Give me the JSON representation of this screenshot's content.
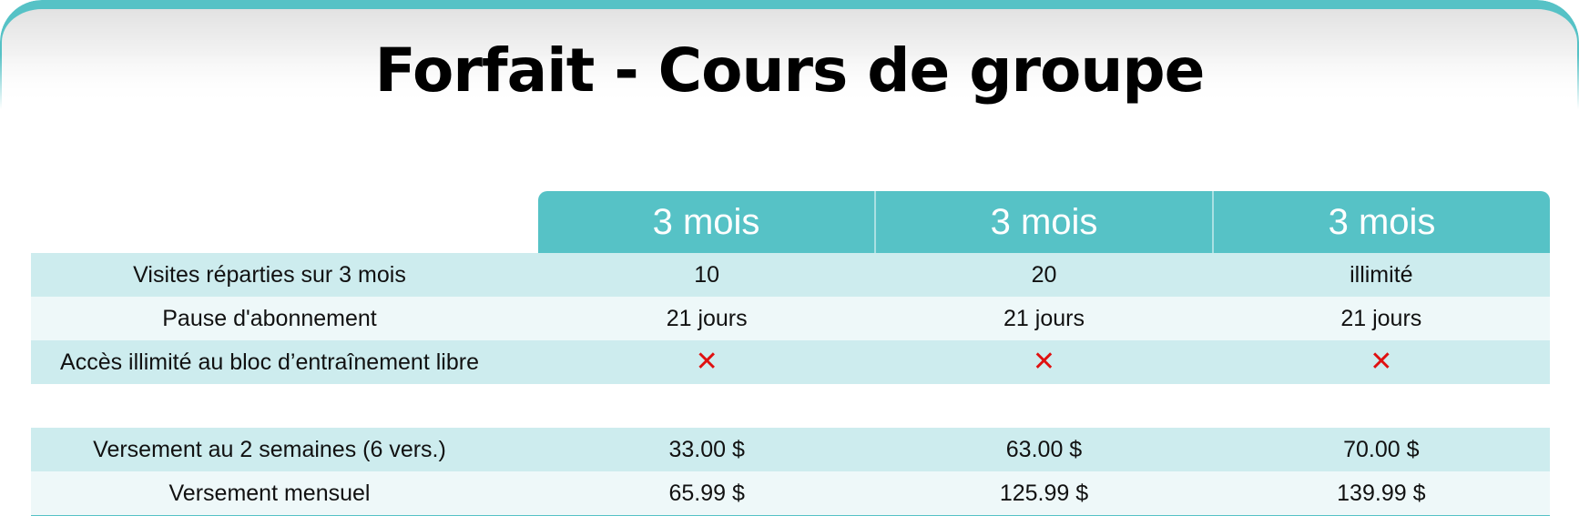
{
  "title": "Forfait - Cours de groupe",
  "colors": {
    "accent": "#56c2c6",
    "row_dark": "#cdecee",
    "row_light": "#eef8f9",
    "cross": "#e01010"
  },
  "plans": [
    "3 mois",
    "3 mois",
    "3 mois"
  ],
  "feature_rows": [
    {
      "label": "Visites réparties sur 3 mois",
      "values": [
        "10",
        "20",
        "illimité"
      ]
    },
    {
      "label": "Pause d'abonnement",
      "values": [
        "21 jours",
        "21 jours",
        "21 jours"
      ]
    },
    {
      "label": "Accès illimité au bloc d’entraînement libre",
      "icons": [
        "cross-icon",
        "cross-icon",
        "cross-icon"
      ],
      "glyph": "✕"
    }
  ],
  "price_rows": [
    {
      "label": "Versement au 2 semaines (6 vers.)",
      "values": [
        "33.00 $",
        "63.00 $",
        "70.00 $"
      ]
    },
    {
      "label": "Versement mensuel",
      "values": [
        "65.99 $",
        "125.99 $",
        "139.99 $"
      ]
    }
  ]
}
